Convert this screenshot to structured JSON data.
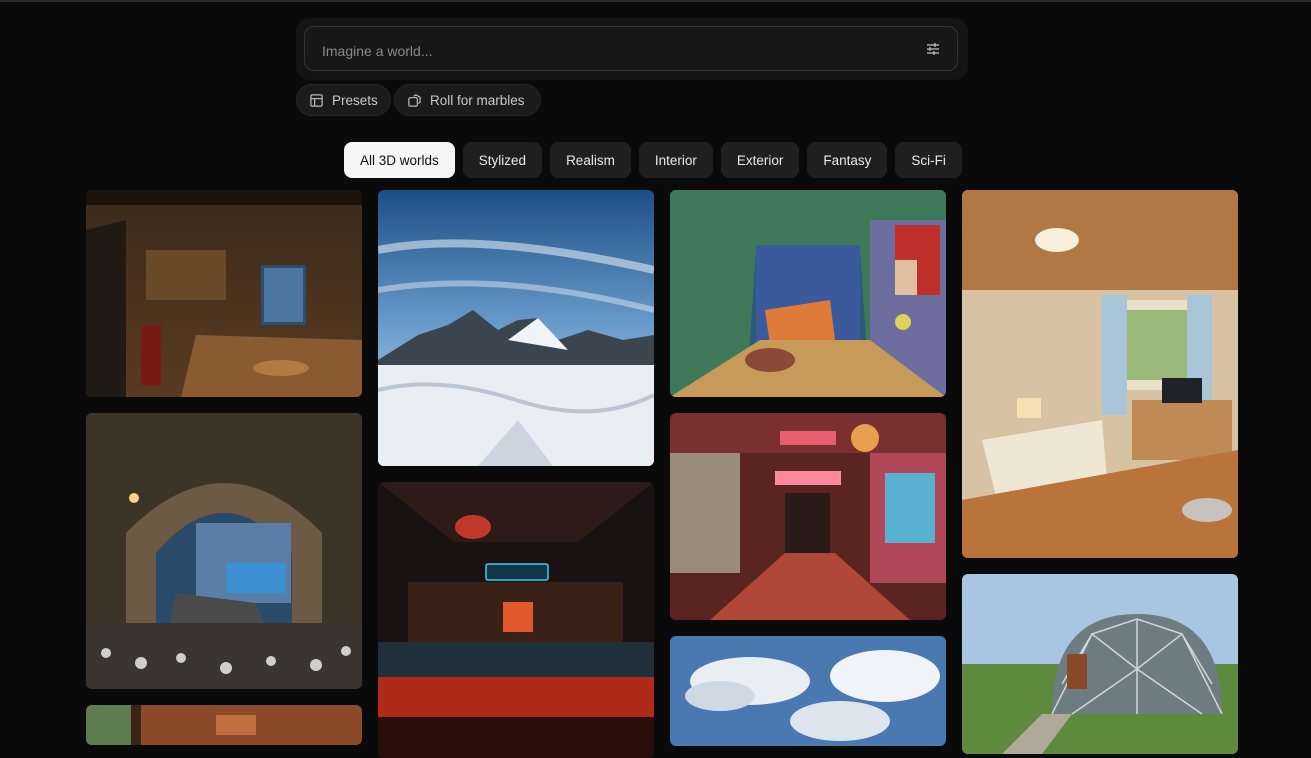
{
  "search": {
    "placeholder": "Imagine a world...",
    "value": ""
  },
  "actions": {
    "presets_label": "Presets",
    "roll_label": "Roll for marbles"
  },
  "tabs": [
    {
      "label": "All 3D worlds",
      "active": true
    },
    {
      "label": "Stylized",
      "active": false
    },
    {
      "label": "Realism",
      "active": false
    },
    {
      "label": "Interior",
      "active": false
    },
    {
      "label": "Exterior",
      "active": false
    },
    {
      "label": "Fantasy",
      "active": false
    },
    {
      "label": "Sci-Fi",
      "active": false
    }
  ],
  "gallery": {
    "columns": [
      [
        "cluttered-wooden-kitchen",
        "stone-archway-canal",
        "wooden-room-partial"
      ],
      [
        "snowy-mountain-peaks",
        "neon-bar-interior"
      ],
      [
        "painted-bedroom",
        "arcade-alley-street",
        "cloudy-sky"
      ],
      [
        "cozy-bedroom",
        "geodesic-dome"
      ]
    ]
  },
  "colors": {
    "background": "#0a0a0a",
    "active_tab_bg": "#f5f5f5",
    "tab_bg": "#1f1f1f"
  }
}
